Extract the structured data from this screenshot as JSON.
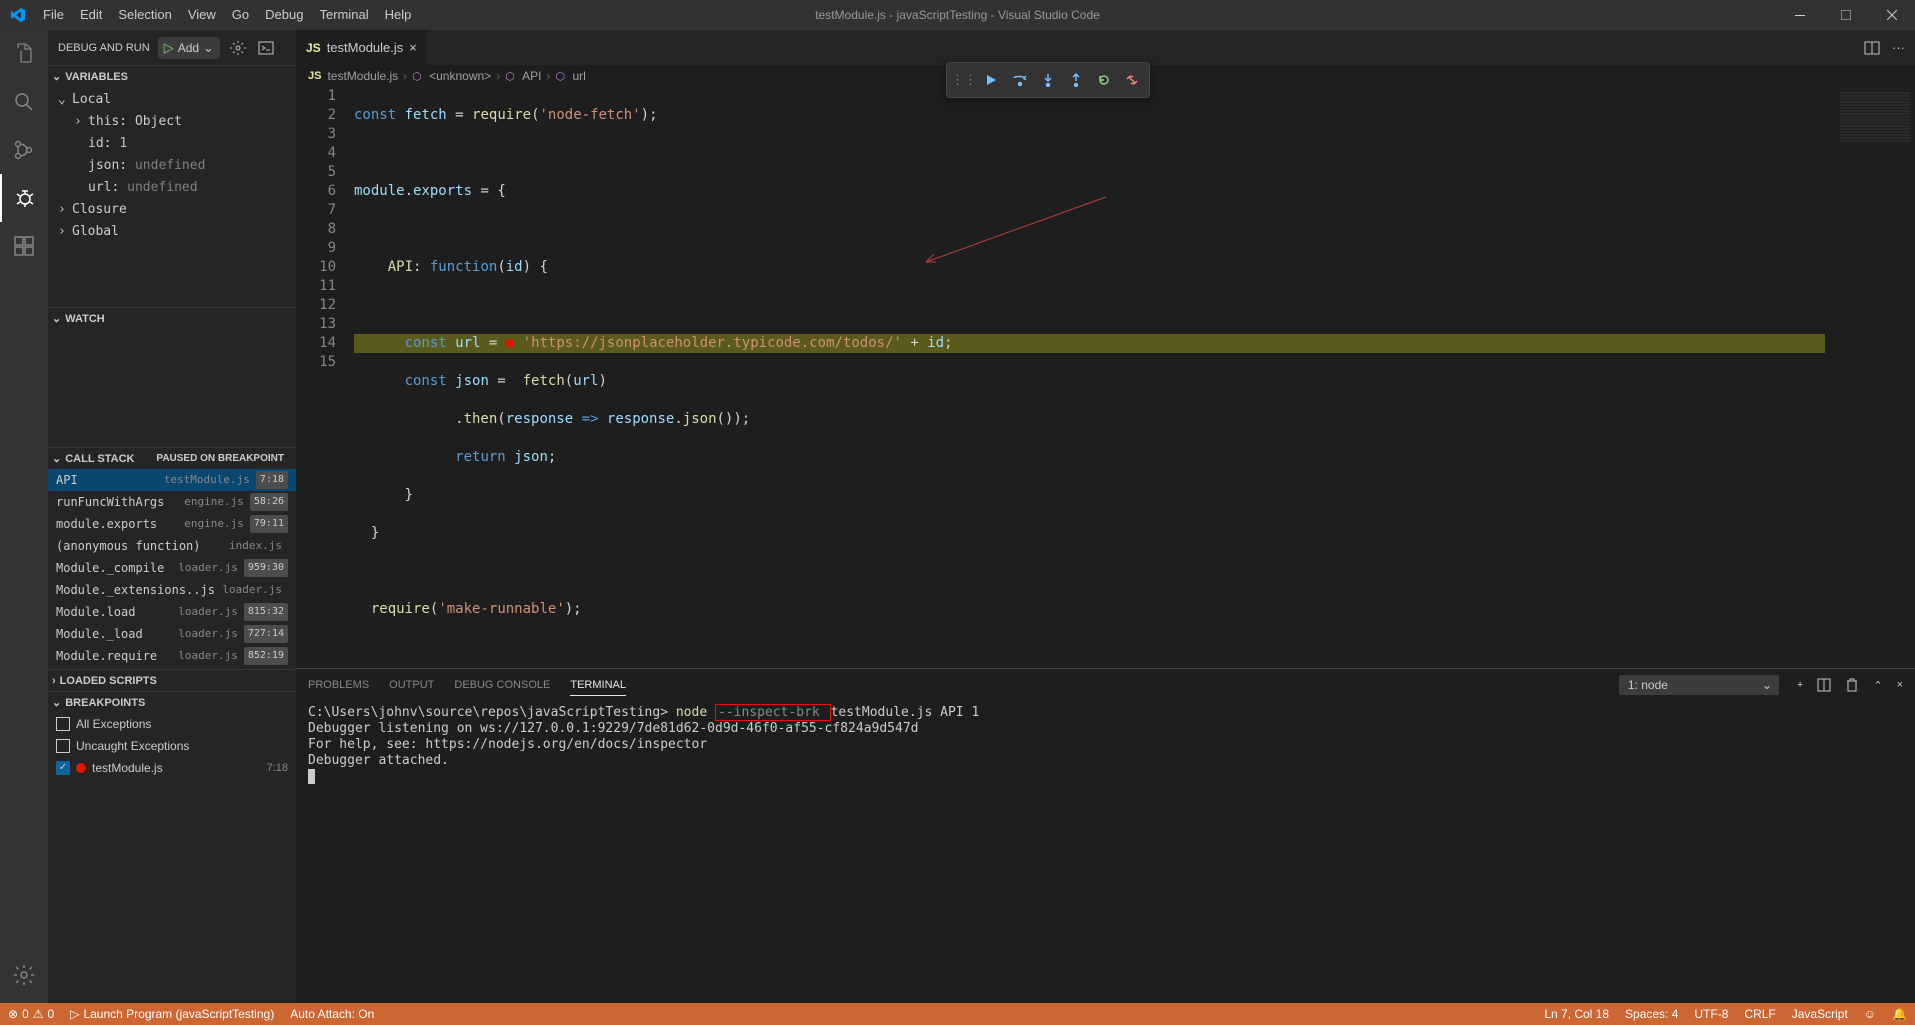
{
  "title": "testModule.js - javaScriptTesting - Visual Studio Code",
  "menubar": [
    "File",
    "Edit",
    "Selection",
    "View",
    "Go",
    "Debug",
    "Terminal",
    "Help"
  ],
  "sidebar": {
    "header_label": "DEBUG AND RUN",
    "config_label": "Add",
    "sections": {
      "variables": "VARIABLES",
      "watch": "WATCH",
      "callstack": "CALL STACK",
      "paused": "PAUSED ON BREAKPOINT",
      "loaded": "LOADED SCRIPTS",
      "breakpoints": "BREAKPOINTS"
    },
    "vars": {
      "scope_local": "Local",
      "scope_closure": "Closure",
      "scope_global": "Global",
      "this_key": "this:",
      "this_val": "Object",
      "id_key": "id:",
      "id_val": "1",
      "json_key": "json:",
      "json_val": "undefined",
      "url_key": "url:",
      "url_val": "undefined"
    },
    "stack": [
      {
        "name": "API",
        "file": "testModule.js",
        "pos": "7:18",
        "selected": true
      },
      {
        "name": "runFuncWithArgs",
        "file": "engine.js",
        "pos": "58:26"
      },
      {
        "name": "module.exports",
        "file": "engine.js",
        "pos": "79:11"
      },
      {
        "name": "(anonymous function)",
        "file": "index.js",
        "pos": ""
      },
      {
        "name": "Module._compile",
        "file": "loader.js",
        "pos": "959:30"
      },
      {
        "name": "Module._extensions..js",
        "file": "loader.js",
        "pos": ""
      },
      {
        "name": "Module.load",
        "file": "loader.js",
        "pos": "815:32"
      },
      {
        "name": "Module._load",
        "file": "loader.js",
        "pos": "727:14"
      },
      {
        "name": "Module.require",
        "file": "loader.js",
        "pos": "852:19"
      }
    ],
    "breakpoints": {
      "all_ex": "All Exceptions",
      "uncaught_ex": "Uncaught Exceptions",
      "file_bp": "testModule.js",
      "file_pos": "7:18"
    }
  },
  "tab": {
    "name": "testModule.js"
  },
  "breadcrumb": {
    "file": "testModule.js",
    "unknown": "<unknown>",
    "api": "API",
    "url": "url"
  },
  "code": {
    "lines": [
      "1",
      "2",
      "3",
      "4",
      "5",
      "6",
      "7",
      "8",
      "9",
      "10",
      "11",
      "12",
      "13",
      "14",
      "15"
    ]
  },
  "panel": {
    "tabs": {
      "problems": "PROBLEMS",
      "output": "OUTPUT",
      "debug": "DEBUG CONSOLE",
      "terminal": "TERMINAL"
    },
    "terminal_name": "1: node",
    "terminal_lines": {
      "prompt": "C:\\Users\\johnv\\source\\repos\\javaScriptTesting> ",
      "cmd1": "node ",
      "inspect": "--inspect-brk ",
      "cmd2": "testModule.js API 1",
      "l2": "Debugger listening on ws://127.0.0.1:9229/7de81d62-0d9d-46f0-af55-cf824a9d547d",
      "l3": "For help, see: https://nodejs.org/en/docs/inspector",
      "l4": "Debugger attached."
    }
  },
  "statusbar": {
    "err": "0",
    "warn": "0",
    "launch": "Launch Program (javaScriptTesting)",
    "auto": "Auto Attach: On",
    "ln": "Ln 7, Col 18",
    "spaces": "Spaces: 4",
    "enc": "UTF-8",
    "eol": "CRLF",
    "lang": "JavaScript"
  }
}
